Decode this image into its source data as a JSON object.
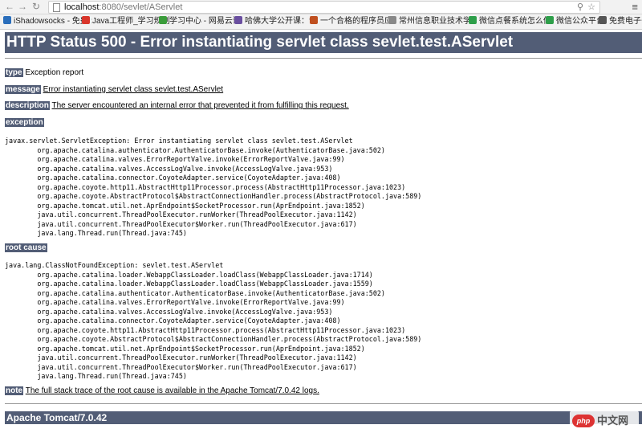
{
  "browser": {
    "url_host": "localhost",
    "url_path": ":8080/sevlet/AServlet",
    "bookmarks": [
      {
        "label": "iShadowsocks - 免费",
        "color": "#2a6ebb"
      },
      {
        "label": "Java工程师_学习规划",
        "color": "#d9362b"
      },
      {
        "label": "学习中心 - 网易云课",
        "color": "#3b9d3b"
      },
      {
        "label": "哈佛大学公开课：计",
        "color": "#6a4fa0"
      },
      {
        "label": "一个合格的程序员应",
        "color": "#c05020"
      },
      {
        "label": "常州信息职业技术学",
        "color": "#888888"
      },
      {
        "label": "微信点餐系统怎么做",
        "color": "#2e9f4a"
      },
      {
        "label": "微信公众平台",
        "color": "#2e9f4a"
      },
      {
        "label": "免费电子书下载",
        "color": "#555555"
      }
    ]
  },
  "page": {
    "title": "HTTP Status 500 - Error instantiating servlet class sevlet.test.AServlet",
    "type_label": "type",
    "type_value": "Exception report",
    "message_label": "message",
    "message_value": "Error instantiating servlet class sevlet.test.AServlet",
    "description_label": "description",
    "description_value": "The server encountered an internal error that prevented it from fulfilling this request.",
    "exception_label": "exception",
    "exception_trace": "javax.servlet.ServletException: Error instantiating servlet class sevlet.test.AServlet\n\torg.apache.catalina.authenticator.AuthenticatorBase.invoke(AuthenticatorBase.java:502)\n\torg.apache.catalina.valves.ErrorReportValve.invoke(ErrorReportValve.java:99)\n\torg.apache.catalina.valves.AccessLogValve.invoke(AccessLogValve.java:953)\n\torg.apache.catalina.connector.CoyoteAdapter.service(CoyoteAdapter.java:408)\n\torg.apache.coyote.http11.AbstractHttp11Processor.process(AbstractHttp11Processor.java:1023)\n\torg.apache.coyote.AbstractProtocol$AbstractConnectionHandler.process(AbstractProtocol.java:589)\n\torg.apache.tomcat.util.net.AprEndpoint$SocketProcessor.run(AprEndpoint.java:1852)\n\tjava.util.concurrent.ThreadPoolExecutor.runWorker(ThreadPoolExecutor.java:1142)\n\tjava.util.concurrent.ThreadPoolExecutor$Worker.run(ThreadPoolExecutor.java:617)\n\tjava.lang.Thread.run(Thread.java:745)",
    "root_cause_label": "root cause",
    "root_cause_trace": "java.lang.ClassNotFoundException: sevlet.test.AServlet\n\torg.apache.catalina.loader.WebappClassLoader.loadClass(WebappClassLoader.java:1714)\n\torg.apache.catalina.loader.WebappClassLoader.loadClass(WebappClassLoader.java:1559)\n\torg.apache.catalina.authenticator.AuthenticatorBase.invoke(AuthenticatorBase.java:502)\n\torg.apache.catalina.valves.ErrorReportValve.invoke(ErrorReportValve.java:99)\n\torg.apache.catalina.valves.AccessLogValve.invoke(AccessLogValve.java:953)\n\torg.apache.catalina.connector.CoyoteAdapter.service(CoyoteAdapter.java:408)\n\torg.apache.coyote.http11.AbstractHttp11Processor.process(AbstractHttp11Processor.java:1023)\n\torg.apache.coyote.AbstractProtocol$AbstractConnectionHandler.process(AbstractProtocol.java:589)\n\torg.apache.tomcat.util.net.AprEndpoint$SocketProcessor.run(AprEndpoint.java:1852)\n\tjava.util.concurrent.ThreadPoolExecutor.runWorker(ThreadPoolExecutor.java:1142)\n\tjava.util.concurrent.ThreadPoolExecutor$Worker.run(ThreadPoolExecutor.java:617)\n\tjava.lang.Thread.run(Thread.java:745)",
    "note_label": "note",
    "note_value": "The full stack trace of the root cause is available in the Apache Tomcat/7.0.42 logs.",
    "footer": "Apache Tomcat/7.0.42"
  },
  "watermark": {
    "logo_text": "php",
    "site_text": "中文网"
  }
}
